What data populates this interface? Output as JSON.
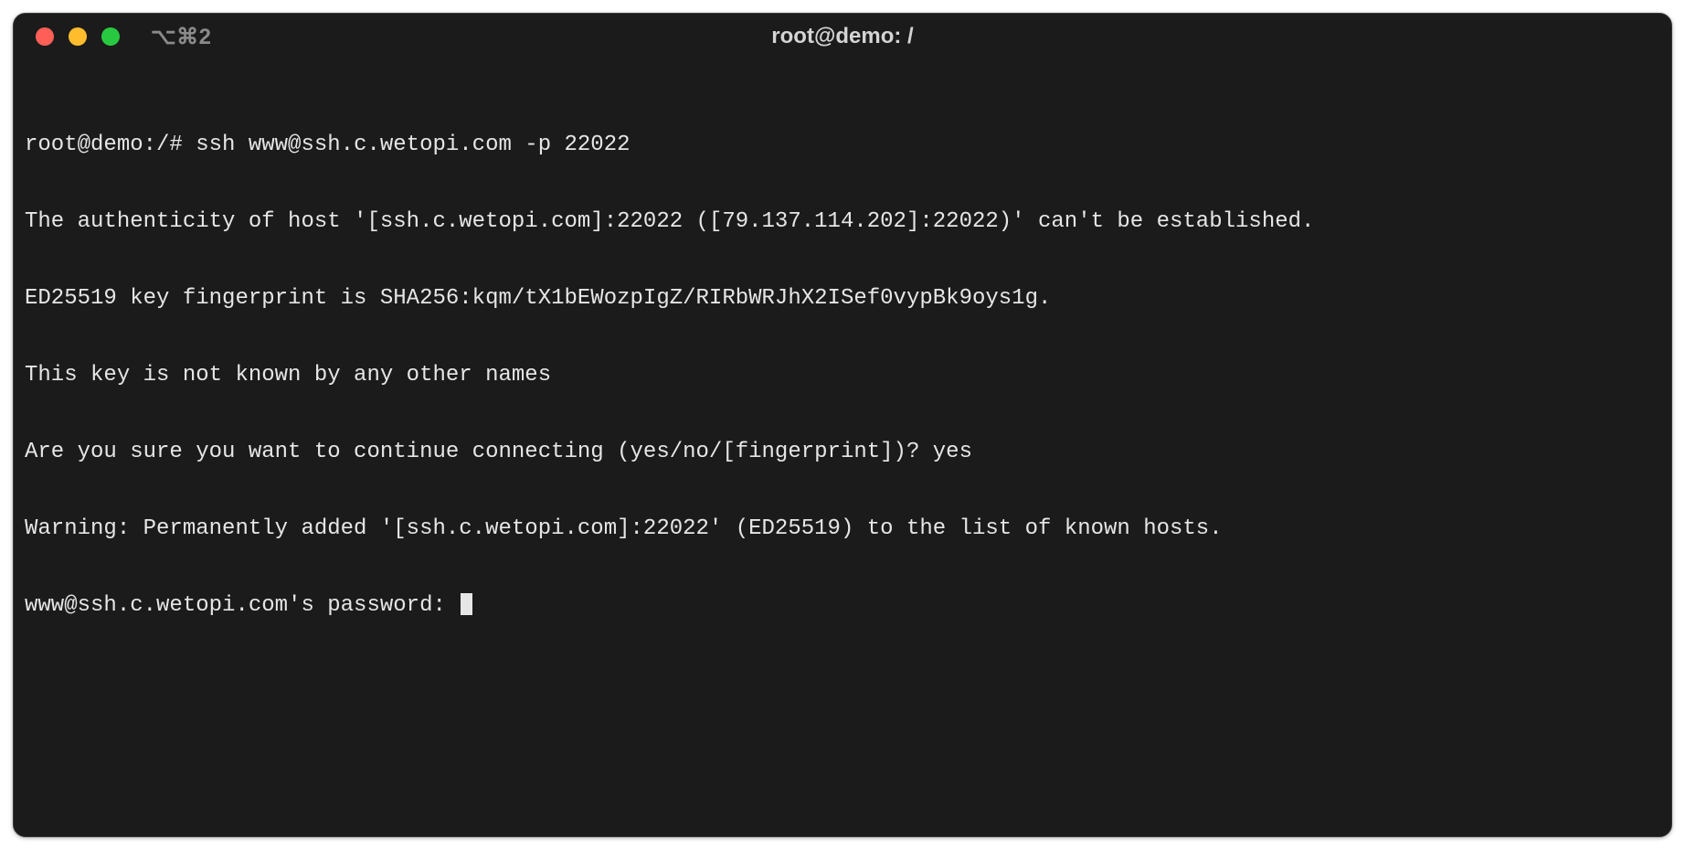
{
  "window": {
    "title": "root@demo: /",
    "tab_badge": "⌥⌘2"
  },
  "terminal": {
    "prompt": "root@demo:/# ",
    "command": "ssh www@ssh.c.wetopi.com -p 22022",
    "lines": {
      "l1": "The authenticity of host '[ssh.c.wetopi.com]:22022 ([79.137.114.202]:22022)' can't be established.",
      "l2": "ED25519 key fingerprint is SHA256:kqm/tX1bEWozpIgZ/RIRbWRJhX2ISef0vypBk9oys1g.",
      "l3": "This key is not known by any other names",
      "l4_prompt": "Are you sure you want to continue connecting (yes/no/[fingerprint])? ",
      "l4_answer": "yes",
      "l5": "Warning: Permanently added '[ssh.c.wetopi.com]:22022' (ED25519) to the list of known hosts.",
      "l6": "www@ssh.c.wetopi.com's password: "
    }
  }
}
